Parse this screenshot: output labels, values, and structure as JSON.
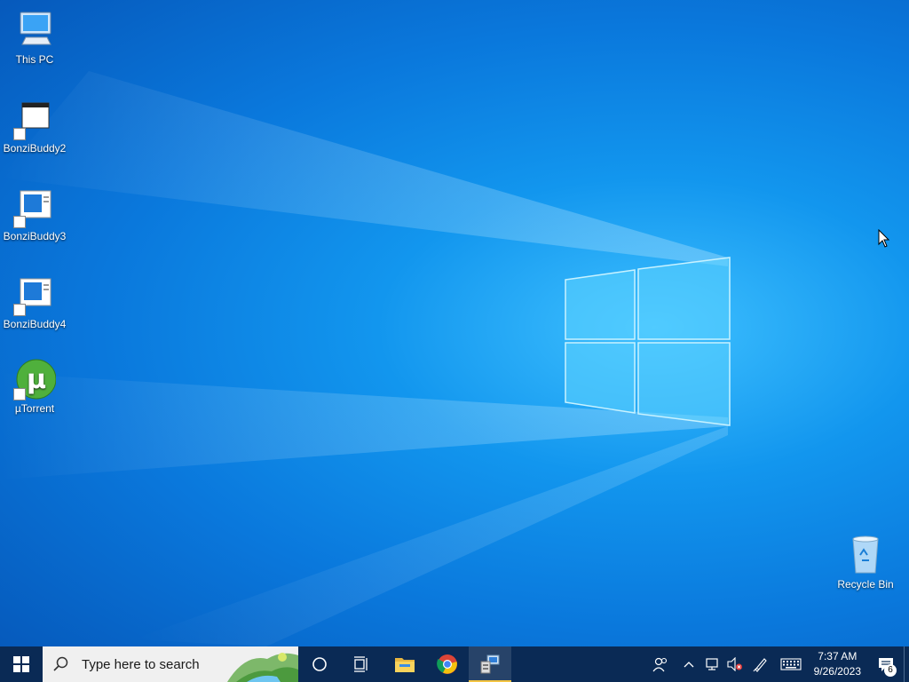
{
  "desktop": {
    "icons": [
      {
        "label": "This PC",
        "icon": "computer-icon"
      },
      {
        "label": "BonziBuddy2",
        "icon": "window-shortcut-icon"
      },
      {
        "label": "BonziBuddy3",
        "icon": "window-shortcut-icon"
      },
      {
        "label": "BonziBuddy4",
        "icon": "window-shortcut-icon"
      },
      {
        "label": "µTorrent",
        "icon": "utorrent-icon"
      }
    ],
    "recycle_bin": {
      "label": "Recycle Bin",
      "icon": "recycle-bin-icon"
    }
  },
  "taskbar": {
    "search_placeholder": "Type here to search",
    "apps": [
      {
        "name": "Cortana",
        "icon": "cortana-icon"
      },
      {
        "name": "Task View",
        "icon": "task-view-icon"
      },
      {
        "name": "File Explorer",
        "icon": "folder-icon"
      },
      {
        "name": "Google Chrome",
        "icon": "chrome-icon"
      },
      {
        "name": "Running app",
        "icon": "app-window-icon",
        "active": true
      }
    ],
    "tray": {
      "time": "7:37 AM",
      "date": "9/26/2023",
      "notifications_count": "6"
    }
  },
  "colors": {
    "taskbar": "#0a2a55",
    "active_indicator": "#f4c542",
    "desktop_accent": "#1296ee"
  }
}
